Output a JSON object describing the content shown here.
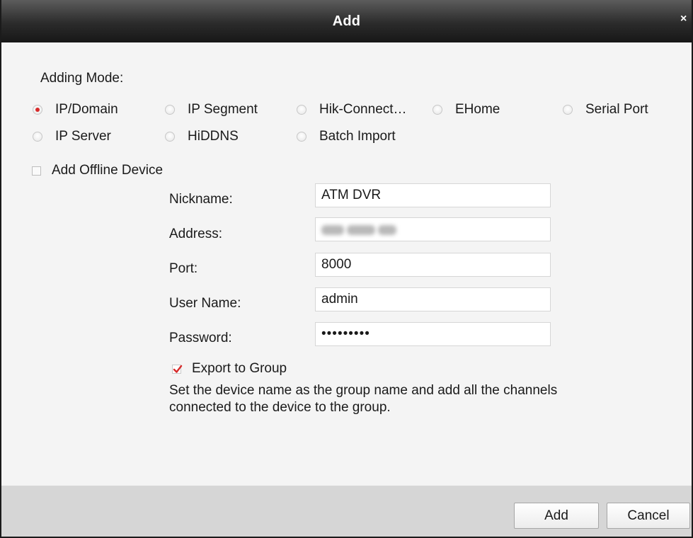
{
  "dialog": {
    "title": "Add",
    "close_glyph": "×"
  },
  "adding_mode": {
    "label": "Adding Mode:",
    "selected": "IP/Domain",
    "options": [
      {
        "label": "IP/Domain",
        "checked": true
      },
      {
        "label": "IP Segment",
        "checked": false
      },
      {
        "label": "Hik-Connect…",
        "checked": false
      },
      {
        "label": "EHome",
        "checked": false
      },
      {
        "label": "Serial Port",
        "checked": false
      },
      {
        "label": "IP Server",
        "checked": false
      },
      {
        "label": "HiDDNS",
        "checked": false
      },
      {
        "label": "Batch Import",
        "checked": false
      }
    ]
  },
  "offline_device": {
    "label": "Add Offline Device",
    "checked": false
  },
  "form": {
    "nickname": {
      "label": "Nickname:",
      "value": "ATM DVR"
    },
    "address": {
      "label": "Address:",
      "value": ""
    },
    "port": {
      "label": "Port:",
      "value": "8000"
    },
    "username": {
      "label": "User Name:",
      "value": "admin"
    },
    "password": {
      "label": "Password:",
      "value": "passwords"
    }
  },
  "export_group": {
    "label": "Export to Group",
    "checked": true,
    "description": "Set the device name as the group name and add all the channels connected to the device to the group."
  },
  "buttons": {
    "add": "Add",
    "cancel": "Cancel"
  },
  "colors": {
    "radio_selected": "#d72a2a",
    "titlebar": "#2b2b2b",
    "footer": "#d6d6d6"
  }
}
